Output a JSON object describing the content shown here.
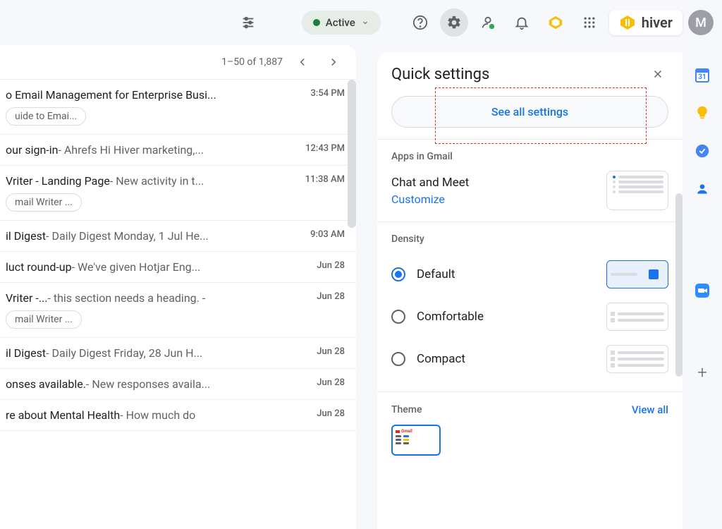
{
  "topbar": {
    "active_label": "Active",
    "hiver_text": "hiver",
    "avatar_initial": "M"
  },
  "mail": {
    "pagination": "1–50 of 1,887",
    "rows": [
      {
        "subject": "o Email Management for Enterprise Busi...",
        "preview": "",
        "chip": "uide to Emai...",
        "time": "3:54 PM"
      },
      {
        "subject": "our sign-in",
        "preview": " - Ahrefs Hi Hiver marketing,...",
        "chip": "",
        "time": "12:43 PM"
      },
      {
        "subject": "Vriter - Landing Page",
        "preview": " - New activity in t...",
        "chip": "mail Writer ...",
        "time": "11:38 AM"
      },
      {
        "subject": "il Digest",
        "preview": " - Daily Digest Monday, 1 Jul He...",
        "chip": "",
        "time": "9:03 AM"
      },
      {
        "subject": "luct round-up",
        "preview": " - We've given Hotjar Eng...",
        "chip": "",
        "time": "Jun 28"
      },
      {
        "subject": "Vriter -...",
        "preview": " - this section needs a heading. -",
        "chip": "mail Writer ...",
        "time": "Jun 28"
      },
      {
        "subject": "il Digest",
        "preview": " - Daily Digest Friday, 28 Jun H...",
        "chip": "",
        "time": "Jun 28"
      },
      {
        "subject": "onses available.",
        "preview": " - New responses availa...",
        "chip": "",
        "time": "Jun 28"
      },
      {
        "subject": "re about Mental Health",
        "preview": " - How much do",
        "chip": "",
        "time": "Jun 28"
      }
    ]
  },
  "settings": {
    "title": "Quick settings",
    "see_all": "See all settings",
    "apps_section": "Apps in Gmail",
    "apps_name": "Chat and Meet",
    "apps_customize": "Customize",
    "density_section": "Density",
    "density_options": [
      "Default",
      "Comfortable",
      "Compact"
    ],
    "density_selected": 0,
    "theme_section": "Theme",
    "theme_viewall": "View all"
  }
}
